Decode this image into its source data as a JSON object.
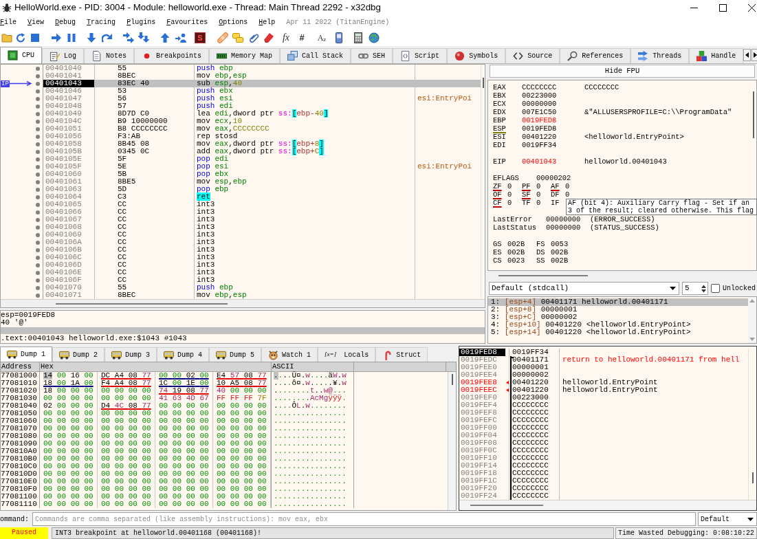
{
  "window": {
    "title": "HelloWorld.exe - PID: 3004 - Module: helloworld.exe - Thread: Main Thread 2292 - x32dbg"
  },
  "menu": [
    "File",
    "View",
    "Debug",
    "Tracing",
    "Plugins",
    "Favourites",
    "Options",
    "Help"
  ],
  "build_info": "Apr 11 2022 (TitanEngine)",
  "toolbar": {
    "text_buttons": [
      "S",
      "fx",
      "#",
      "A$_{z}$"
    ]
  },
  "tabs": [
    {
      "label": "CPU",
      "selected": true
    },
    {
      "label": "Log",
      "selected": false
    },
    {
      "label": "Notes",
      "selected": false
    },
    {
      "label": "Breakpoints",
      "selected": false
    },
    {
      "label": "Memory Map",
      "selected": false
    },
    {
      "label": "Call Stack",
      "selected": false
    },
    {
      "label": "SEH",
      "selected": false
    },
    {
      "label": "Script",
      "selected": false
    },
    {
      "label": "Symbols",
      "selected": false
    },
    {
      "label": "Source",
      "selected": false
    },
    {
      "label": "References",
      "selected": false
    },
    {
      "label": "Threads",
      "selected": false
    },
    {
      "label": "Handle",
      "selected": false
    }
  ],
  "disassembly": {
    "ip_label": "IP",
    "rows": [
      {
        "address": "00401040",
        "bytes": "55",
        "instruction": [
          {
            "text": "push ",
            "kind": "stack"
          },
          {
            "text": "ebp",
            "kind": "reg"
          }
        ],
        "selected": false,
        "ip": false
      },
      {
        "address": "00401041",
        "bytes": "8BEC",
        "instruction": [
          {
            "text": "mov ",
            "kind": "op"
          },
          {
            "text": "ebp",
            "kind": "reg"
          },
          {
            "text": ",",
            "kind": "op"
          },
          {
            "text": "esp",
            "kind": "reg"
          }
        ],
        "selected": false,
        "ip": false
      },
      {
        "address": "00401043",
        "bytes": "83EC 40",
        "instruction": [
          {
            "text": "sub ",
            "kind": "op"
          },
          {
            "text": "esp",
            "kind": "reg"
          },
          {
            "text": ",",
            "kind": "op"
          },
          {
            "text": "40",
            "kind": "num"
          }
        ],
        "selected": true,
        "ip": true
      },
      {
        "address": "00401046",
        "bytes": "53",
        "instruction": [
          {
            "text": "push ",
            "kind": "stack"
          },
          {
            "text": "ebx",
            "kind": "reg"
          }
        ],
        "selected": false,
        "ip": false
      },
      {
        "address": "00401047",
        "bytes": "56",
        "instruction": [
          {
            "text": "push ",
            "kind": "stack"
          },
          {
            "text": "esi",
            "kind": "reg"
          }
        ],
        "comment": "esi:EntryPoi",
        "selected": false,
        "ip": false
      },
      {
        "address": "00401048",
        "bytes": "57",
        "instruction": [
          {
            "text": "push ",
            "kind": "stack"
          },
          {
            "text": "edi",
            "kind": "reg"
          }
        ],
        "selected": false,
        "ip": false
      },
      {
        "address": "00401049",
        "bytes": "8D7D C0",
        "instruction": [
          {
            "text": "lea ",
            "kind": "op"
          },
          {
            "text": "edi",
            "kind": "reg"
          },
          {
            "text": ",dword ptr ",
            "kind": "op"
          },
          {
            "text": "ss:",
            "kind": "seg"
          },
          {
            "text": "[",
            "kind": "brk"
          },
          {
            "text": "ebp-",
            "kind": "mreg"
          },
          {
            "text": "40",
            "kind": "num"
          },
          {
            "text": "]",
            "kind": "brk"
          }
        ],
        "selected": false,
        "ip": false
      },
      {
        "address": "0040104C",
        "bytes": "B9 10000000",
        "instruction": [
          {
            "text": "mov ",
            "kind": "op"
          },
          {
            "text": "ecx",
            "kind": "reg"
          },
          {
            "text": ",",
            "kind": "op"
          },
          {
            "text": "10",
            "kind": "num"
          }
        ],
        "selected": false,
        "ip": false
      },
      {
        "address": "00401051",
        "bytes": "B8 CCCCCCCC",
        "instruction": [
          {
            "text": "mov ",
            "kind": "op"
          },
          {
            "text": "eax",
            "kind": "reg"
          },
          {
            "text": ",",
            "kind": "op"
          },
          {
            "text": "CCCCCCCC",
            "kind": "num"
          }
        ],
        "selected": false,
        "ip": false
      },
      {
        "address": "00401056",
        "bytes": "F3:AB",
        "instruction": [
          {
            "text": "rep stosd",
            "kind": "op"
          }
        ],
        "selected": false,
        "ip": false
      },
      {
        "address": "00401058",
        "bytes": "8B45 08",
        "instruction": [
          {
            "text": "mov ",
            "kind": "op"
          },
          {
            "text": "eax",
            "kind": "reg"
          },
          {
            "text": ",dword ptr ",
            "kind": "op"
          },
          {
            "text": "ss:",
            "kind": "seg"
          },
          {
            "text": "[",
            "kind": "brk"
          },
          {
            "text": "ebp+",
            "kind": "mreg"
          },
          {
            "text": "8",
            "kind": "num"
          },
          {
            "text": "]",
            "kind": "brk"
          }
        ],
        "selected": false,
        "ip": false
      },
      {
        "address": "0040105B",
        "bytes": "0345 0C",
        "instruction": [
          {
            "text": "add ",
            "kind": "op"
          },
          {
            "text": "eax",
            "kind": "reg"
          },
          {
            "text": ",dword ptr ",
            "kind": "op"
          },
          {
            "text": "ss:",
            "kind": "seg"
          },
          {
            "text": "[",
            "kind": "brk"
          },
          {
            "text": "ebp+",
            "kind": "mreg"
          },
          {
            "text": "C",
            "kind": "num"
          },
          {
            "text": "]",
            "kind": "brk"
          }
        ],
        "selected": false,
        "ip": false
      },
      {
        "address": "0040105E",
        "bytes": "5F",
        "instruction": [
          {
            "text": "pop ",
            "kind": "stack"
          },
          {
            "text": "edi",
            "kind": "reg"
          }
        ],
        "selected": false,
        "ip": false
      },
      {
        "address": "0040105F",
        "bytes": "5E",
        "instruction": [
          {
            "text": "pop ",
            "kind": "stack"
          },
          {
            "text": "esi",
            "kind": "reg"
          }
        ],
        "comment": "esi:EntryPoi",
        "selected": false,
        "ip": false
      },
      {
        "address": "00401060",
        "bytes": "5B",
        "instruction": [
          {
            "text": "pop ",
            "kind": "stack"
          },
          {
            "text": "ebx",
            "kind": "reg"
          }
        ],
        "selected": false,
        "ip": false
      },
      {
        "address": "00401061",
        "bytes": "8BE5",
        "instruction": [
          {
            "text": "mov ",
            "kind": "op"
          },
          {
            "text": "esp",
            "kind": "reg"
          },
          {
            "text": ",",
            "kind": "op"
          },
          {
            "text": "ebp",
            "kind": "reg"
          }
        ],
        "selected": false,
        "ip": false
      },
      {
        "address": "00401063",
        "bytes": "5D",
        "instruction": [
          {
            "text": "pop ",
            "kind": "stack"
          },
          {
            "text": "ebp",
            "kind": "reg"
          }
        ],
        "selected": false,
        "ip": false
      },
      {
        "address": "00401064",
        "bytes": "C3",
        "instruction": [
          {
            "text": "ret",
            "kind": "ret"
          }
        ],
        "selected": false,
        "ip": false
      },
      {
        "address": "00401065",
        "bytes": "CC",
        "instruction": [
          {
            "text": "int3",
            "kind": "op"
          }
        ],
        "selected": false,
        "ip": false
      },
      {
        "address": "00401066",
        "bytes": "CC",
        "instruction": [
          {
            "text": "int3",
            "kind": "op"
          }
        ],
        "selected": false,
        "ip": false
      },
      {
        "address": "00401067",
        "bytes": "CC",
        "instruction": [
          {
            "text": "int3",
            "kind": "op"
          }
        ],
        "selected": false,
        "ip": false
      },
      {
        "address": "00401068",
        "bytes": "CC",
        "instruction": [
          {
            "text": "int3",
            "kind": "op"
          }
        ],
        "selected": false,
        "ip": false
      },
      {
        "address": "00401069",
        "bytes": "CC",
        "instruction": [
          {
            "text": "int3",
            "kind": "op"
          }
        ],
        "selected": false,
        "ip": false
      },
      {
        "address": "0040106A",
        "bytes": "CC",
        "instruction": [
          {
            "text": "int3",
            "kind": "op"
          }
        ],
        "selected": false,
        "ip": false
      },
      {
        "address": "0040106B",
        "bytes": "CC",
        "instruction": [
          {
            "text": "int3",
            "kind": "op"
          }
        ],
        "selected": false,
        "ip": false
      },
      {
        "address": "0040106C",
        "bytes": "CC",
        "instruction": [
          {
            "text": "int3",
            "kind": "op"
          }
        ],
        "selected": false,
        "ip": false
      },
      {
        "address": "0040106D",
        "bytes": "CC",
        "instruction": [
          {
            "text": "int3",
            "kind": "op"
          }
        ],
        "selected": false,
        "ip": false
      },
      {
        "address": "0040106E",
        "bytes": "CC",
        "instruction": [
          {
            "text": "int3",
            "kind": "op"
          }
        ],
        "selected": false,
        "ip": false
      },
      {
        "address": "0040106F",
        "bytes": "CC",
        "instruction": [
          {
            "text": "int3",
            "kind": "op"
          }
        ],
        "selected": false,
        "ip": false
      },
      {
        "address": "00401070",
        "bytes": "55",
        "instruction": [
          {
            "text": "push ",
            "kind": "stack"
          },
          {
            "text": "ebp",
            "kind": "reg"
          }
        ],
        "selected": false,
        "ip": false
      },
      {
        "address": "00401071",
        "bytes": "8BEC",
        "instruction": [
          {
            "text": "mov ",
            "kind": "op"
          },
          {
            "text": "ebp",
            "kind": "reg"
          },
          {
            "text": ",",
            "kind": "op"
          },
          {
            "text": "esp",
            "kind": "reg"
          }
        ],
        "selected": false,
        "ip": false
      }
    ]
  },
  "info": {
    "lines": [
      "esp=0019FED8",
      "40 '@'"
    ],
    "location": ".text:00401043 helloworld.exe:$1043 #1043"
  },
  "registers": {
    "toggle": "Hide FPU",
    "general": [
      {
        "name": "EAX",
        "value": "CCCCCCCC",
        "comment": "CCCCCCCC",
        "changed": false,
        "underlined": false
      },
      {
        "name": "EBX",
        "value": "00223000",
        "changed": false,
        "underlined": false
      },
      {
        "name": "ECX",
        "value": "00000000",
        "changed": false,
        "underlined": false
      },
      {
        "name": "EDX",
        "value": "007E1C50",
        "comment": "&\"ALLUSERSPROFILE=C:\\\\ProgramData\"",
        "changed": false,
        "underlined": false
      },
      {
        "name": "EBP",
        "value": "0019FED8",
        "changed": true,
        "underlined": false
      },
      {
        "name": "ESP",
        "value": "0019FED8",
        "changed": false,
        "underlined": true
      },
      {
        "name": "ESI",
        "value": "00401220",
        "comment": "<helloworld.EntryPoint>",
        "changed": false,
        "underlined": false
      },
      {
        "name": "EDI",
        "value": "0019FF34",
        "changed": false,
        "underlined": false
      }
    ],
    "eip": {
      "name": "EIP",
      "value": "00401043",
      "comment": "helloworld.00401043",
      "changed": true
    },
    "eflags": {
      "name": "EFLAGS",
      "value": "00000202"
    },
    "flags": [
      {
        "name": "ZF",
        "value": "0",
        "underlined": true
      },
      {
        "name": "PF",
        "value": "0",
        "underlined": true
      },
      {
        "name": "AF",
        "value": "0",
        "underlined": true
      },
      {
        "name": "OF",
        "value": "0",
        "underlined": true
      },
      {
        "name": "SF",
        "value": "0",
        "underlined": true
      },
      {
        "name": "DF",
        "value": "0",
        "underlined": false
      },
      {
        "name": "CF",
        "value": "0",
        "underlined": true
      },
      {
        "name": "TF",
        "value": "0",
        "underlined": false
      },
      {
        "name": "IF",
        "underlined": false
      }
    ],
    "status": [
      {
        "name": "LastError",
        "value": "00000000",
        "comment": "(ERROR_SUCCESS)"
      },
      {
        "name": "LastStatus",
        "value": "00000000",
        "comment": "(STATUS_SUCCESS)"
      }
    ],
    "segments": [
      {
        "name": "GS",
        "value": "002B"
      },
      {
        "name": "FS",
        "value": "0053"
      },
      {
        "name": "ES",
        "value": "002B"
      },
      {
        "name": "DS",
        "value": "002B"
      },
      {
        "name": "CS",
        "value": "0023"
      },
      {
        "name": "SS",
        "value": "002B"
      }
    ]
  },
  "tooltip": {
    "lines": [
      "AF (bit 4): Auxiliary Carry flag - Set if an",
      "3 of the result; cleared otherwise. This flag"
    ]
  },
  "arguments": {
    "convention": "Default (stdcall)",
    "count": "5",
    "lock": {
      "label": "Unlocked",
      "checked": false
    },
    "rows": [
      {
        "index": "1:",
        "location": "[esp+4]",
        "value": "00401171",
        "comment": "helloworld.00401171",
        "selected": true
      },
      {
        "index": "2:",
        "location": "[esp+8]",
        "value": "00000001",
        "selected": false
      },
      {
        "index": "3:",
        "location": "[esp+C]",
        "value": "00000002",
        "selected": false
      },
      {
        "index": "4:",
        "location": "[esp+10]",
        "value": "00401220",
        "comment": "<helloworld.EntryPoint>",
        "selected": false
      },
      {
        "index": "5:",
        "location": "[esp+14]",
        "value": "00401220",
        "comment": "<helloworld.EntryPoint>",
        "selected": false
      }
    ]
  },
  "dump": {
    "tabs": [
      {
        "label": "Dump 1",
        "kind": "dump",
        "selected": true
      },
      {
        "label": "Dump 2",
        "kind": "dump",
        "selected": false
      },
      {
        "label": "Dump 3",
        "kind": "dump",
        "selected": false
      },
      {
        "label": "Dump 4",
        "kind": "dump",
        "selected": false
      },
      {
        "label": "Dump 5",
        "kind": "dump",
        "selected": false
      },
      {
        "label": "Watch 1",
        "kind": "watch",
        "selected": false
      },
      {
        "label": "Locals",
        "kind": "locals",
        "icon_text": "[x=]",
        "selected": false
      },
      {
        "label": "Struct",
        "kind": "struct",
        "selected": false
      }
    ],
    "columns": [
      "Address",
      "Hex",
      "ASCII"
    ],
    "rows": [
      {
        "address": "77081000",
        "hex": [
          {
            "bytes": "14 00 16 00"
          },
          {
            "bytes": "DC A4 08 77",
            "color": "#e00000"
          },
          {
            "bytes": "00 00 02 00",
            "color": "#000080"
          },
          {
            "bytes": "E4 57 08 77",
            "color": "#e00000"
          }
        ],
        "ascii": "....Ü¤.w....äW.w",
        "selected": true
      },
      {
        "address": "77081010",
        "hex": [
          {
            "bytes": "18 00 1A 00",
            "color": "#000080"
          },
          {
            "bytes": "F4 A4 08 77",
            "color": "#e00000"
          },
          {
            "bytes": "1C 00 1E 00",
            "color": "#000080"
          },
          {
            "bytes": "10 A5 08 77",
            "color": "#e00000"
          }
        ],
        "ascii": "....ô¤.w.....¥.w",
        "selected": false
      },
      {
        "address": "77081020",
        "hex": [
          {
            "bytes": "18 00 00 00"
          },
          {
            "bytes": "00 00 00 00"
          },
          {
            "bytes": "74 19 08 77",
            "color": "#e00000"
          },
          {
            "bytes": "40 00 00 00"
          }
        ],
        "ascii": "........t..w@...",
        "selected": false
      },
      {
        "address": "77081030",
        "hex": [
          {
            "bytes": "00 00 00 00"
          },
          {
            "bytes": "00 00 00 00"
          },
          {
            "bytes": "41 63 4D 67"
          },
          {
            "bytes": "FF FF FF 7F"
          }
        ],
        "ascii": "........AcMgÿÿÿ.",
        "selected": false
      },
      {
        "address": "77081040",
        "hex": [
          {
            "bytes": "02 00 00 00"
          },
          {
            "bytes": "D4 4C 08 77",
            "color": "#e00000"
          },
          {
            "bytes": "00 00 00 00"
          },
          {
            "bytes": "00 00 00 00"
          }
        ],
        "ascii": "....ÔL.w........",
        "selected": false
      },
      {
        "address": "77081050",
        "hex": [
          {
            "bytes": "00 00 00 00"
          },
          {
            "bytes": "00 00 00 00"
          },
          {
            "bytes": "00 00 00 00"
          },
          {
            "bytes": "00 00 00 00"
          }
        ],
        "ascii": "................",
        "selected": false
      },
      {
        "address": "77081060",
        "hex": [
          {
            "bytes": "00 00 00 00"
          },
          {
            "bytes": "00 00 00 00"
          },
          {
            "bytes": "00 00 00 00"
          },
          {
            "bytes": "00 00 00 00"
          }
        ],
        "ascii": "................",
        "selected": false
      },
      {
        "address": "77081070",
        "hex": [
          {
            "bytes": "00 00 00 00"
          },
          {
            "bytes": "00 00 00 00"
          },
          {
            "bytes": "00 00 00 00"
          },
          {
            "bytes": "00 00 00 00"
          }
        ],
        "ascii": "................",
        "selected": false
      },
      {
        "address": "77081080",
        "hex": [
          {
            "bytes": "00 00 00 00"
          },
          {
            "bytes": "00 00 00 00"
          },
          {
            "bytes": "00 00 00 00"
          },
          {
            "bytes": "00 00 00 00"
          }
        ],
        "ascii": "................",
        "selected": false
      },
      {
        "address": "77081090",
        "hex": [
          {
            "bytes": "00 00 00 00"
          },
          {
            "bytes": "00 00 00 00"
          },
          {
            "bytes": "00 00 00 00"
          },
          {
            "bytes": "00 00 00 00"
          }
        ],
        "ascii": "................",
        "selected": false
      },
      {
        "address": "770810A0",
        "hex": [
          {
            "bytes": "00 00 00 00"
          },
          {
            "bytes": "00 00 00 00"
          },
          {
            "bytes": "00 00 00 00"
          },
          {
            "bytes": "00 00 00 00"
          }
        ],
        "ascii": "................",
        "selected": false
      },
      {
        "address": "770810B0",
        "hex": [
          {
            "bytes": "00 00 00 00"
          },
          {
            "bytes": "00 00 00 00"
          },
          {
            "bytes": "00 00 00 00"
          },
          {
            "bytes": "00 00 00 00"
          }
        ],
        "ascii": "................",
        "selected": false
      },
      {
        "address": "770810C0",
        "hex": [
          {
            "bytes": "00 00 00 00"
          },
          {
            "bytes": "00 00 00 00"
          },
          {
            "bytes": "00 00 00 00"
          },
          {
            "bytes": "00 00 00 00"
          }
        ],
        "ascii": "................",
        "selected": false
      },
      {
        "address": "770810D0",
        "hex": [
          {
            "bytes": "00 00 00 00"
          },
          {
            "bytes": "00 00 00 00"
          },
          {
            "bytes": "00 00 00 00"
          },
          {
            "bytes": "00 00 00 00"
          }
        ],
        "ascii": "................",
        "selected": false
      },
      {
        "address": "770810E0",
        "hex": [
          {
            "bytes": "00 00 00 00"
          },
          {
            "bytes": "00 00 00 00"
          },
          {
            "bytes": "00 00 00 00"
          },
          {
            "bytes": "00 00 00 00"
          }
        ],
        "ascii": "................",
        "selected": false
      },
      {
        "address": "770810F0",
        "hex": [
          {
            "bytes": "00 00 00 00"
          },
          {
            "bytes": "00 00 00 00"
          },
          {
            "bytes": "00 00 00 00"
          },
          {
            "bytes": "00 00 00 00"
          }
        ],
        "ascii": "................",
        "selected": false
      },
      {
        "address": "77081100",
        "hex": [
          {
            "bytes": "00 00 00 00"
          },
          {
            "bytes": "00 00 00 00"
          },
          {
            "bytes": "00 00 00 00"
          },
          {
            "bytes": "00 00 00 00"
          }
        ],
        "ascii": "................",
        "selected": false
      },
      {
        "address": "77081110",
        "hex": [
          {
            "bytes": "00 00 00 00"
          },
          {
            "bytes": "00 00 00 00"
          },
          {
            "bytes": "00 00 00 00"
          },
          {
            "bytes": "00 00 00 00"
          }
        ],
        "ascii": "................",
        "selected": false
      }
    ]
  },
  "stack": {
    "rows": [
      {
        "address": "0019FED8",
        "value": "0019FF34",
        "selected": true,
        "marked": false,
        "in_frame": false
      },
      {
        "address": "0019FEDC",
        "value": "00401171",
        "comment": {
          "text": "return to helloworld.00401171 from hell",
          "kind": "return"
        },
        "selected": false,
        "marked": false,
        "in_frame": true
      },
      {
        "address": "0019FEE0",
        "value": "00000001",
        "selected": false,
        "marked": false,
        "in_frame": true
      },
      {
        "address": "0019FEE4",
        "value": "00000002",
        "selected": false,
        "marked": false,
        "in_frame": true
      },
      {
        "address": "0019FEE8",
        "value": "00401220",
        "comment": {
          "text": "helloworld.EntryPoint",
          "kind": "label"
        },
        "selected": false,
        "marked": true,
        "in_frame": true
      },
      {
        "address": "0019FEEC",
        "value": "00401220",
        "comment": {
          "text": "helloworld.EntryPoint",
          "kind": "label"
        },
        "selected": false,
        "marked": true,
        "in_frame": true
      },
      {
        "address": "0019FEF0",
        "value": "00223000",
        "selected": false,
        "marked": false,
        "in_frame": true
      },
      {
        "address": "0019FEF4",
        "value": "CCCCCCCC",
        "selected": false,
        "marked": false,
        "in_frame": true
      },
      {
        "address": "0019FEF8",
        "value": "CCCCCCCC",
        "selected": false,
        "marked": false,
        "in_frame": true
      },
      {
        "address": "0019FEFC",
        "value": "CCCCCCCC",
        "selected": false,
        "marked": false,
        "in_frame": true
      },
      {
        "address": "0019FF00",
        "value": "CCCCCCCC",
        "selected": false,
        "marked": false,
        "in_frame": true
      },
      {
        "address": "0019FF04",
        "value": "CCCCCCCC",
        "selected": false,
        "marked": false,
        "in_frame": true
      },
      {
        "address": "0019FF08",
        "value": "CCCCCCCC",
        "selected": false,
        "marked": false,
        "in_frame": true
      },
      {
        "address": "0019FF0C",
        "value": "CCCCCCCC",
        "selected": false,
        "marked": false,
        "in_frame": true
      },
      {
        "address": "0019FF10",
        "value": "CCCCCCCC",
        "selected": false,
        "marked": false,
        "in_frame": true
      },
      {
        "address": "0019FF14",
        "value": "CCCCCCCC",
        "selected": false,
        "marked": false,
        "in_frame": true
      },
      {
        "address": "0019FF18",
        "value": "CCCCCCCC",
        "selected": false,
        "marked": false,
        "in_frame": true
      },
      {
        "address": "0019FF1C",
        "value": "CCCCCCCC",
        "selected": false,
        "marked": false,
        "in_frame": true
      },
      {
        "address": "0019FF20",
        "value": "CCCCCCCC",
        "selected": false,
        "marked": false,
        "in_frame": true
      },
      {
        "address": "0019FF24",
        "value": "CCCCCCCC",
        "selected": false,
        "marked": false,
        "in_frame": true
      }
    ]
  },
  "command": {
    "label": "ommand:",
    "placeholder": "Commands are comma separated (like assembly instructions): mov eax, ebx",
    "mode": "Default"
  },
  "status_bar": {
    "state": "Paused",
    "message": "INT3 breakpoint at helloworld.00401168 (00401168)!",
    "timer": "Time Wasted Debugging: 0:08:10:22"
  }
}
